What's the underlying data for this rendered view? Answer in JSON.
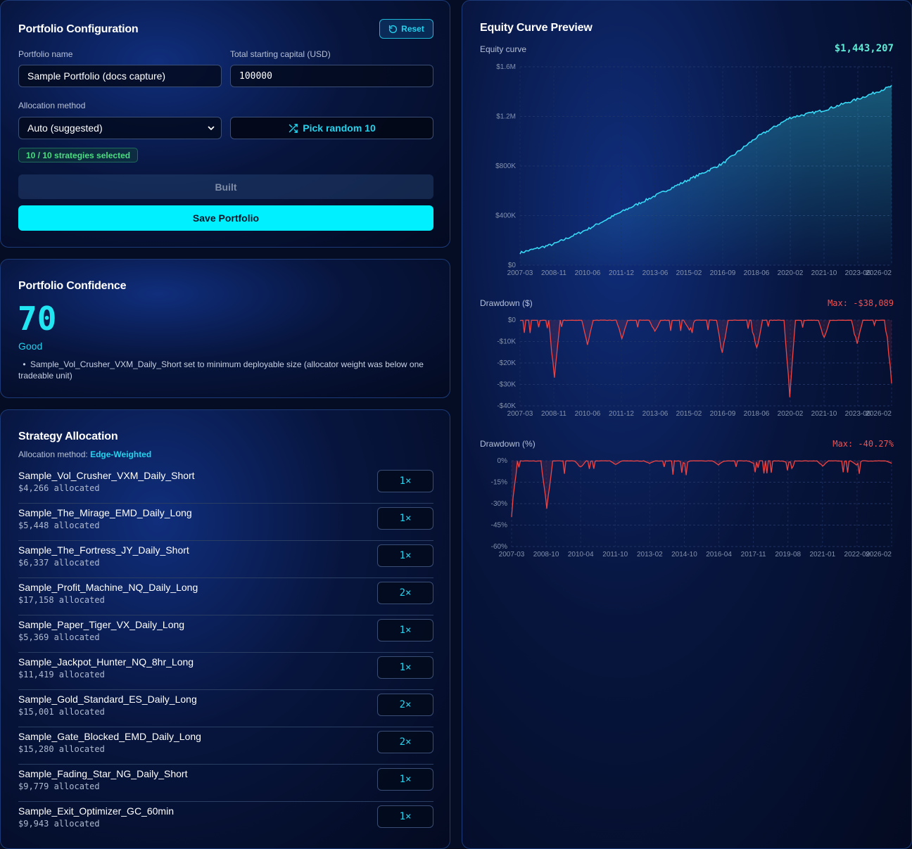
{
  "config": {
    "title": "Portfolio Configuration",
    "reset_label": "Reset",
    "name_label": "Portfolio name",
    "name_value": "Sample Portfolio (docs capture)",
    "capital_label": "Total starting capital (USD)",
    "capital_value": "100000",
    "method_label": "Allocation method",
    "method_value": "Auto (suggested)",
    "pick_random_label": "Pick random 10",
    "selected_badge": "10 / 10 strategies selected",
    "built_label": "Built",
    "save_label": "Save Portfolio"
  },
  "confidence": {
    "title": "Portfolio Confidence",
    "score": "70",
    "rating": "Good",
    "note": "Sample_Vol_Crusher_VXM_Daily_Short set to minimum deployable size (allocator weight was below one tradeable unit)"
  },
  "allocation": {
    "title": "Strategy Allocation",
    "method_prefix": "Allocation method:",
    "method_value": "Edge-Weighted",
    "rows": [
      {
        "name": "Sample_Vol_Crusher_VXM_Daily_Short",
        "amount": "$4,266 allocated",
        "mult": "1×"
      },
      {
        "name": "Sample_The_Mirage_EMD_Daily_Long",
        "amount": "$5,448 allocated",
        "mult": "1×"
      },
      {
        "name": "Sample_The_Fortress_JY_Daily_Short",
        "amount": "$6,337 allocated",
        "mult": "1×"
      },
      {
        "name": "Sample_Profit_Machine_NQ_Daily_Long",
        "amount": "$17,158 allocated",
        "mult": "2×"
      },
      {
        "name": "Sample_Paper_Tiger_VX_Daily_Long",
        "amount": "$5,369 allocated",
        "mult": "1×"
      },
      {
        "name": "Sample_Jackpot_Hunter_NQ_8hr_Long",
        "amount": "$11,419 allocated",
        "mult": "1×"
      },
      {
        "name": "Sample_Gold_Standard_ES_Daily_Long",
        "amount": "$15,001 allocated",
        "mult": "2×"
      },
      {
        "name": "Sample_Gate_Blocked_EMD_Daily_Long",
        "amount": "$15,280 allocated",
        "mult": "2×"
      },
      {
        "name": "Sample_Fading_Star_NG_Daily_Short",
        "amount": "$9,779 allocated",
        "mult": "1×"
      },
      {
        "name": "Sample_Exit_Optimizer_GC_60min",
        "amount": "$9,943 allocated",
        "mult": "1×"
      }
    ]
  },
  "charts": {
    "title": "Equity Curve Preview",
    "equity_label": "Equity curve",
    "equity_value": "$1,443,207",
    "dd_usd_label": "Drawdown ($)",
    "dd_usd_value": "Max: -$38,089",
    "dd_pct_label": "Drawdown (%)",
    "dd_pct_value": "Max: -40.27%"
  },
  "colors": {
    "accent": "#22d3ee",
    "save_button": "#00f0ff",
    "success": "#4ade80",
    "equity_line": "#38d9f5",
    "drawdown_line": "#ef4444",
    "drawdown_value": "#f05252",
    "equity_value": "#5eead4"
  },
  "icons": {
    "reset": "rotate-ccw-icon",
    "pick_random": "shuffle-icon",
    "select": "chevron-down-icon"
  },
  "chart_data": [
    {
      "type": "area",
      "title": "Equity curve",
      "x": [
        "2007-03",
        "2008-11",
        "2010-06",
        "2011-12",
        "2013-06",
        "2015-02",
        "2016-09",
        "2018-06",
        "2020-02",
        "2021-10",
        "2023-06",
        "2026-02"
      ],
      "series": [
        {
          "values": [
            100000,
            170000,
            290000,
            430000,
            560000,
            690000,
            820000,
            1030000,
            1190000,
            1250000,
            1340000,
            1443207
          ]
        }
      ],
      "ylim": [
        0,
        1600000
      ],
      "yticks": [
        "$0",
        "$400K",
        "$800K",
        "$1.2M",
        "$1.6M"
      ]
    },
    {
      "type": "line",
      "title": "Drawdown ($)",
      "x": [
        "2007-03",
        "2008-11",
        "2010-06",
        "2011-12",
        "2013-06",
        "2015-02",
        "2016-09",
        "2018-06",
        "2020-02",
        "2021-10",
        "2023-06",
        "2026-02"
      ],
      "series": [
        {
          "values": [
            0,
            -30000,
            -12000,
            -9000,
            -6000,
            -5000,
            -17000,
            -15000,
            -38089,
            -9000,
            -12000,
            -33000
          ]
        }
      ],
      "ylim": [
        -40000,
        0
      ],
      "yticks": [
        "$0",
        "-$10K",
        "-$20K",
        "-$30K",
        "-$40K"
      ]
    },
    {
      "type": "line",
      "title": "Drawdown (%)",
      "x": [
        "2007-03",
        "2008-10",
        "2010-04",
        "2011-10",
        "2013-02",
        "2014-10",
        "2016-04",
        "2017-11",
        "2019-08",
        "2021-01",
        "2022-09",
        "2026-02"
      ],
      "series": [
        {
          "values": [
            -40.27,
            -38,
            -5,
            -3,
            -2,
            -2,
            -3,
            -2,
            -1.5,
            -4,
            -3,
            -2
          ]
        }
      ],
      "ylim": [
        -60,
        0
      ],
      "yticks": [
        "0%",
        "-15%",
        "-30%",
        "-45%",
        "-60%"
      ]
    }
  ]
}
